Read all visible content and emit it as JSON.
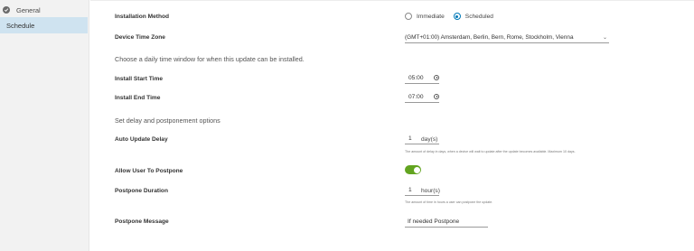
{
  "sidebar": {
    "items": [
      {
        "label": "General"
      },
      {
        "label": "Schedule"
      }
    ]
  },
  "form": {
    "installation_method": {
      "label": "Installation Method",
      "options": [
        "Immediate",
        "Scheduled"
      ],
      "selected": "Scheduled"
    },
    "device_time_zone": {
      "label": "Device Time Zone",
      "value": "(GMT+01:00) Amsterdam, Berlin, Bern, Rome, Stockholm, Vienna"
    },
    "time_window_section": "Choose a daily time window for when this update can be installed.",
    "install_start_time": {
      "label": "Install Start Time",
      "value": "05:00"
    },
    "install_end_time": {
      "label": "Install End Time",
      "value": "07:00"
    },
    "delay_section": "Set delay and postponement options",
    "auto_update_delay": {
      "label": "Auto Update Delay",
      "value": "1",
      "unit": "day(s)",
      "helper": "The amount of delay in days, when a device will wait to update after the update becomes available. Maximum 10 days."
    },
    "allow_user_to_postpone": {
      "label": "Allow User To Postpone",
      "enabled": true
    },
    "postpone_duration": {
      "label": "Postpone Duration",
      "value": "1",
      "unit": "hour(s)",
      "helper": "The amount of time in hours a user can postpone the update."
    },
    "postpone_message": {
      "label": "Postpone Message",
      "value": "If needed Postpone"
    }
  },
  "colors": {
    "accent": "#0079b8",
    "toggle_on": "#62a420",
    "sidebar_selected": "#cfe3f0"
  }
}
